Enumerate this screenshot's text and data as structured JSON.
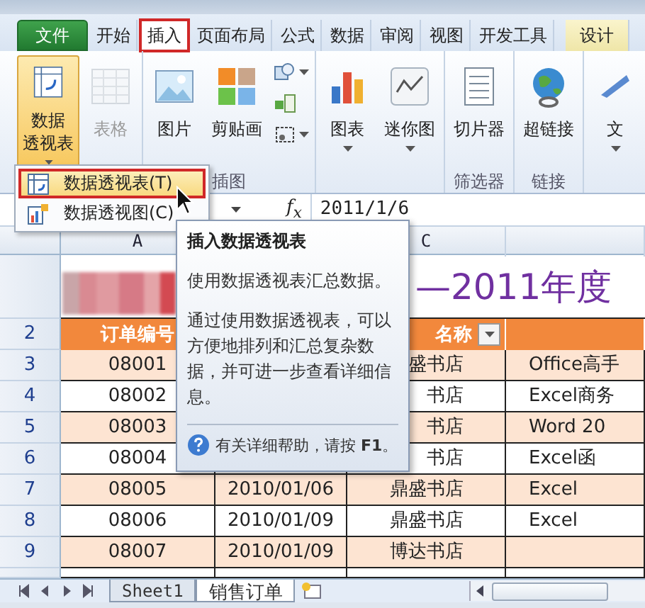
{
  "ribbon_tabs": [
    {
      "label": "文件",
      "kind": "file",
      "selected": false,
      "highlighted": false
    },
    {
      "label": "开始",
      "kind": "normal",
      "selected": false,
      "highlighted": false
    },
    {
      "label": "插入",
      "kind": "normal",
      "selected": true,
      "highlighted": true
    },
    {
      "label": "页面布局",
      "kind": "normal",
      "selected": false,
      "highlighted": false
    },
    {
      "label": "公式",
      "kind": "normal",
      "selected": false,
      "highlighted": false
    },
    {
      "label": "数据",
      "kind": "normal",
      "selected": false,
      "highlighted": false
    },
    {
      "label": "审阅",
      "kind": "normal",
      "selected": false,
      "highlighted": false
    },
    {
      "label": "视图",
      "kind": "normal",
      "selected": false,
      "highlighted": false
    },
    {
      "label": "开发工具",
      "kind": "normal",
      "selected": false,
      "highlighted": false
    },
    {
      "label": "设计",
      "kind": "contextual",
      "selected": false,
      "highlighted": false
    }
  ],
  "ribbon_groups": [
    {
      "buttons": [
        {
          "kind": "large",
          "label": [
            "数据",
            "透视表"
          ],
          "pressed": true,
          "disabled": false,
          "dropdown": true
        },
        {
          "kind": "large",
          "label": [
            "表格"
          ],
          "pressed": false,
          "disabled": true,
          "dropdown": false
        }
      ]
    },
    {
      "label": "插图",
      "buttons": [
        {
          "kind": "large",
          "label": [
            "图片"
          ],
          "pressed": false,
          "disabled": false,
          "dropdown": false
        },
        {
          "kind": "large",
          "label": [
            "剪贴画"
          ],
          "pressed": false,
          "disabled": false,
          "dropdown": false
        },
        {
          "kind": "small",
          "dropdown": true
        },
        {
          "kind": "small",
          "dropdown": false
        },
        {
          "kind": "small",
          "dropdown": true
        }
      ]
    },
    {
      "buttons": [
        {
          "kind": "large",
          "label": [
            "图表"
          ],
          "pressed": false,
          "disabled": false,
          "dropdown": true
        },
        {
          "kind": "large",
          "label": [
            "迷你图"
          ],
          "pressed": false,
          "disabled": false,
          "dropdown": true
        }
      ]
    },
    {
      "label": "筛选器",
      "buttons": [
        {
          "kind": "large",
          "label": [
            "切片器"
          ],
          "pressed": false,
          "disabled": false,
          "dropdown": false
        }
      ]
    },
    {
      "label": "链接",
      "buttons": [
        {
          "kind": "large",
          "label": [
            "超链接"
          ],
          "pressed": false,
          "disabled": false,
          "dropdown": false
        }
      ]
    },
    {
      "buttons": [
        {
          "kind": "large",
          "label": [
            "文"
          ],
          "pressed": false,
          "disabled": false,
          "dropdown": true
        }
      ]
    }
  ],
  "dropdown_menu": [
    {
      "label": "数据透视表(T)",
      "selected": true,
      "highlighted": true
    },
    {
      "label": "数据透视图(C)",
      "selected": false,
      "highlighted": false
    }
  ],
  "formula_bar": {
    "function_label": "f$_{x}$",
    "value": "2011/1/6"
  },
  "columns": [
    {
      "header": "A"
    },
    {},
    {
      "header": "C"
    },
    {}
  ],
  "sheet_title": "—2011年度",
  "header_row": {
    "number": "2",
    "A": "订单编号",
    "C": "名称"
  },
  "rows": [
    {
      "number": "3",
      "shaded": true,
      "A": "08001",
      "C": "盛书店",
      "D": "Office高手"
    },
    {
      "number": "4",
      "shaded": false,
      "A": "08002",
      "C": "书店",
      "D": "Excel商务"
    },
    {
      "number": "5",
      "shaded": true,
      "A": "08003",
      "C": "书店",
      "D": "Word 20"
    },
    {
      "number": "6",
      "shaded": false,
      "A": "08004",
      "C": "书店",
      "D": "Excel函"
    },
    {
      "number": "7",
      "shaded": true,
      "A": "08005",
      "B": "2010/01/06",
      "C": "鼎盛书店",
      "D": "Excel"
    },
    {
      "number": "8",
      "shaded": false,
      "A": "08006",
      "B": "2010/01/09",
      "C": "鼎盛书店",
      "D": "Excel"
    },
    {
      "number": "9",
      "shaded": true,
      "A": "08007",
      "B": "2010/01/09",
      "C": "博达书店"
    }
  ],
  "tooltip": {
    "title": "插入数据透视表",
    "paragraphs": [
      "使用数据透视表汇总数据。",
      "通过使用数据透视表，可以方便地排列和汇总复杂数据，并可进一步查看详细信息。"
    ],
    "help": "有关详细帮助，请按 **F1**。"
  },
  "sheet_tabs": [
    {
      "label": "Sheet1",
      "selected": false
    },
    {
      "label": "销售订单",
      "selected": true
    }
  ]
}
